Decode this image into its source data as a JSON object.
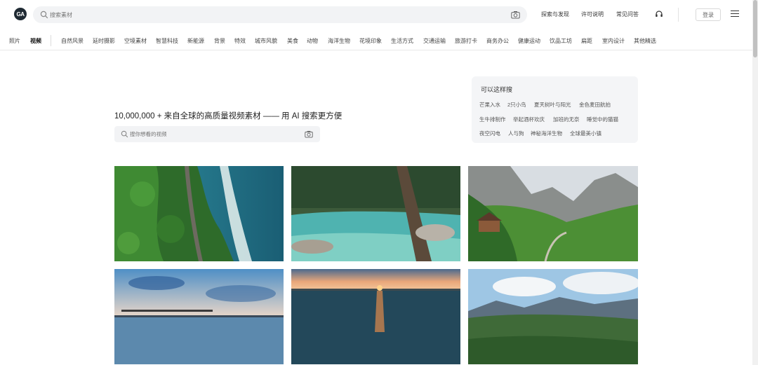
{
  "header": {
    "logo_text": "GA",
    "search_placeholder": "搜索素材",
    "nav": [
      "探索与发现",
      "许可说明",
      "常见问答"
    ],
    "login_label": "登录"
  },
  "categories": {
    "items": [
      "照片",
      "视频",
      "自然风景",
      "延时摄影",
      "空境素材",
      "智慧科技",
      "新能源",
      "背景",
      "特效",
      "城市风貌",
      "美食",
      "动物",
      "海洋生物",
      "花境印象",
      "生活方式",
      "交通运输",
      "旅游打卡",
      "商务办公",
      "健康运动",
      "饮品工坊",
      "扁距",
      "室内设计",
      "其他精选"
    ],
    "active": "视频"
  },
  "hero": {
    "title": "10,000,000 + 来自全球的高质量视频素材 —— 用 AI 搜索更方便",
    "search_placeholder": "搜你想看的视频"
  },
  "suggest": {
    "title": "可以这样搜",
    "tags": [
      [
        "芒果入水",
        "2只小鸟",
        "夏天树叶与阳光",
        "金色麦田航拍"
      ],
      [
        "生牛排制作",
        "举起酒杯欢庆",
        "加班的无奈",
        "睡觉中的猫猫"
      ],
      [
        "夜空闪电",
        "人与狗",
        "神秘海洋生物",
        "全球最美小镇"
      ]
    ]
  },
  "grid": {
    "images": [
      "aerial-coast-forest",
      "forest-river-turquoise",
      "alpine-village-valley",
      "tropical-pier-sunset",
      "ocean-sunset",
      "mountain-forest-clouds"
    ]
  }
}
